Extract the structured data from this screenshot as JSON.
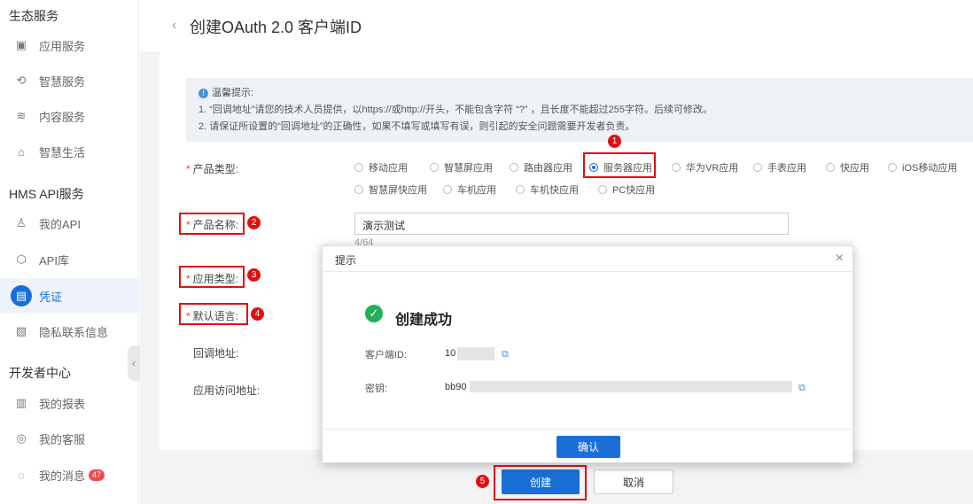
{
  "sidebar": {
    "group1": "生态服务",
    "items1": [
      {
        "label": "应用服务",
        "icon": "app-service-icon"
      },
      {
        "label": "智慧服务",
        "icon": "smart-service-icon"
      },
      {
        "label": "内容服务",
        "icon": "content-service-icon"
      },
      {
        "label": "智慧生活",
        "icon": "smart-life-icon"
      }
    ],
    "group2": "HMS API服务",
    "items2": [
      {
        "label": "我的API",
        "icon": "my-api-icon"
      },
      {
        "label": "API库",
        "icon": "api-library-icon"
      },
      {
        "label": "凭证",
        "icon": "credential-icon"
      },
      {
        "label": "隐私联系信息",
        "icon": "privacy-contact-icon"
      }
    ],
    "group3": "开发者中心",
    "items3": [
      {
        "label": "我的报表",
        "icon": "report-icon"
      },
      {
        "label": "我的客服",
        "icon": "customer-service-icon"
      },
      {
        "label": "我的消息",
        "icon": "message-icon",
        "badge": "47"
      }
    ]
  },
  "header": {
    "back": "‹",
    "title": "创建OAuth 2.0 客户端ID"
  },
  "tips": {
    "title": "温馨提示:",
    "line1": "1. “回调地址”请您的技术人员提供，以https://或http://开头，不能包含字符 “?” ，且长度不能超过255字符。后续可修改。",
    "line2": "2. 请保证所设置的“回调地址”的正确性，如果不填写或填写有误，则引起的安全问题需要开发者负责。"
  },
  "form": {
    "product_type_label": "产品类型:",
    "product_types_row1": [
      "移动应用",
      "智慧屏应用",
      "路由器应用",
      "服务器应用",
      "华为VR应用",
      "手表应用",
      "快应用",
      "iOS移动应用"
    ],
    "product_types_row2": [
      "智慧屏快应用",
      "车机应用",
      "车机快应用",
      "PC快应用"
    ],
    "selected_type": "服务器应用",
    "product_name_label": "产品名称:",
    "product_name_value": "演示测试",
    "product_name_counter": "4/64",
    "app_type_label": "应用类型:",
    "default_lang_label": "默认语言:",
    "callback_label": "回调地址:",
    "app_url_label": "应用访问地址:",
    "required_mark": "*"
  },
  "buttons": {
    "create": "创建",
    "cancel": "取消"
  },
  "steps": [
    "1",
    "2",
    "3",
    "4",
    "5"
  ],
  "modal": {
    "title": "提示",
    "close": "×",
    "success_text": "创建成功",
    "client_id_label": "客户端ID:",
    "client_id_value": "10",
    "secret_label": "密钥:",
    "secret_value": "bb90",
    "confirm": "确认"
  },
  "colors": {
    "accent": "#1a6fd6",
    "annotation": "#e01010",
    "success": "#20b15a"
  }
}
